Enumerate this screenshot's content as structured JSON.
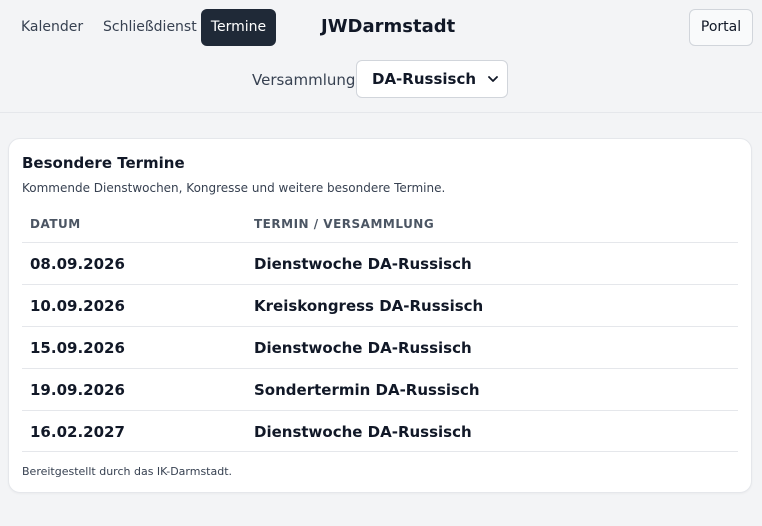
{
  "nav": {
    "items": [
      {
        "label": "Kalender",
        "active": false
      },
      {
        "label": "Schließdienst",
        "active": false
      },
      {
        "label": "Termine",
        "active": true
      }
    ],
    "title": "JWDarmstadt",
    "portal_label": "Portal"
  },
  "filter": {
    "label": "Versammlung",
    "selected": "DA-Russisch"
  },
  "card": {
    "title": "Besondere Termine",
    "subtitle": "Kommende Dienstwochen, Kongresse und weitere besondere Termine.",
    "columns": [
      "DATUM",
      "TERMIN / VERSAMMLUNG"
    ],
    "rows": [
      {
        "date": "08.09.2026",
        "event": "Dienstwoche DA-Russisch"
      },
      {
        "date": "10.09.2026",
        "event": "Kreiskongress DA-Russisch"
      },
      {
        "date": "15.09.2026",
        "event": "Dienstwoche DA-Russisch"
      },
      {
        "date": "19.09.2026",
        "event": "Sondertermin DA-Russisch"
      },
      {
        "date": "16.02.2027",
        "event": "Dienstwoche DA-Russisch"
      }
    ],
    "footer": "Bereitgestellt durch das IK-Darmstadt."
  },
  "colors": {
    "active_nav_bg": "#1f2937",
    "page_bg": "#f3f4f6",
    "card_bg": "#ffffff"
  }
}
